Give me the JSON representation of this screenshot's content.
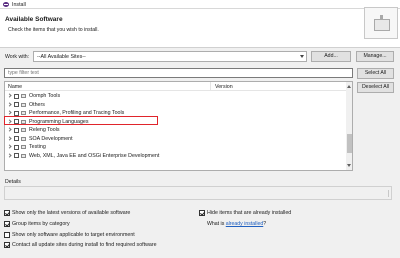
{
  "window": {
    "title": "Install"
  },
  "header": {
    "title": "Available Software",
    "subtitle": "Check the items that you wish to install."
  },
  "work_with": {
    "label": "Work with:",
    "value": "--All Available Sites--",
    "add_label": "Add...",
    "manage_label": "Manage..."
  },
  "filter": {
    "placeholder": "type filter text"
  },
  "buttons": {
    "select_all": "Select All",
    "deselect_all": "Deselect All"
  },
  "tree": {
    "columns": {
      "name": "Name",
      "version": "Version"
    },
    "rows": [
      {
        "label": "Oomph Tools"
      },
      {
        "label": "Others"
      },
      {
        "label": "Performance, Profiling and Tracing Tools"
      },
      {
        "label": "Programming Languages"
      },
      {
        "label": "Releng Tools"
      },
      {
        "label": "SOA Development"
      },
      {
        "label": "Testing"
      },
      {
        "label": "Web, XML, Java EE and OSGi Enterprise Development"
      }
    ],
    "highlighted_row": "Programming Languages"
  },
  "details": {
    "label": "Details"
  },
  "options": {
    "latest_versions": {
      "label": "Show only the latest versions of available software",
      "checked": true
    },
    "group_by_category": {
      "label": "Group items by category",
      "checked": true
    },
    "applicable_only": {
      "label": "Show only software applicable to target environment",
      "checked": false
    },
    "contact_sites": {
      "label": "Contact all update sites during install to find required software",
      "checked": true
    },
    "hide_installed": {
      "label": "Hide items that are already installed",
      "checked": true
    },
    "what_is_prefix": "What is ",
    "already_installed_link": "already installed",
    "what_is_suffix": "?"
  },
  "colors": {
    "highlight_border": "#e0242b",
    "link": "#2060c0"
  },
  "icons": [
    "app-icon",
    "chevron-right-icon",
    "category-icon",
    "scroll-up-icon",
    "scroll-down-icon"
  ]
}
